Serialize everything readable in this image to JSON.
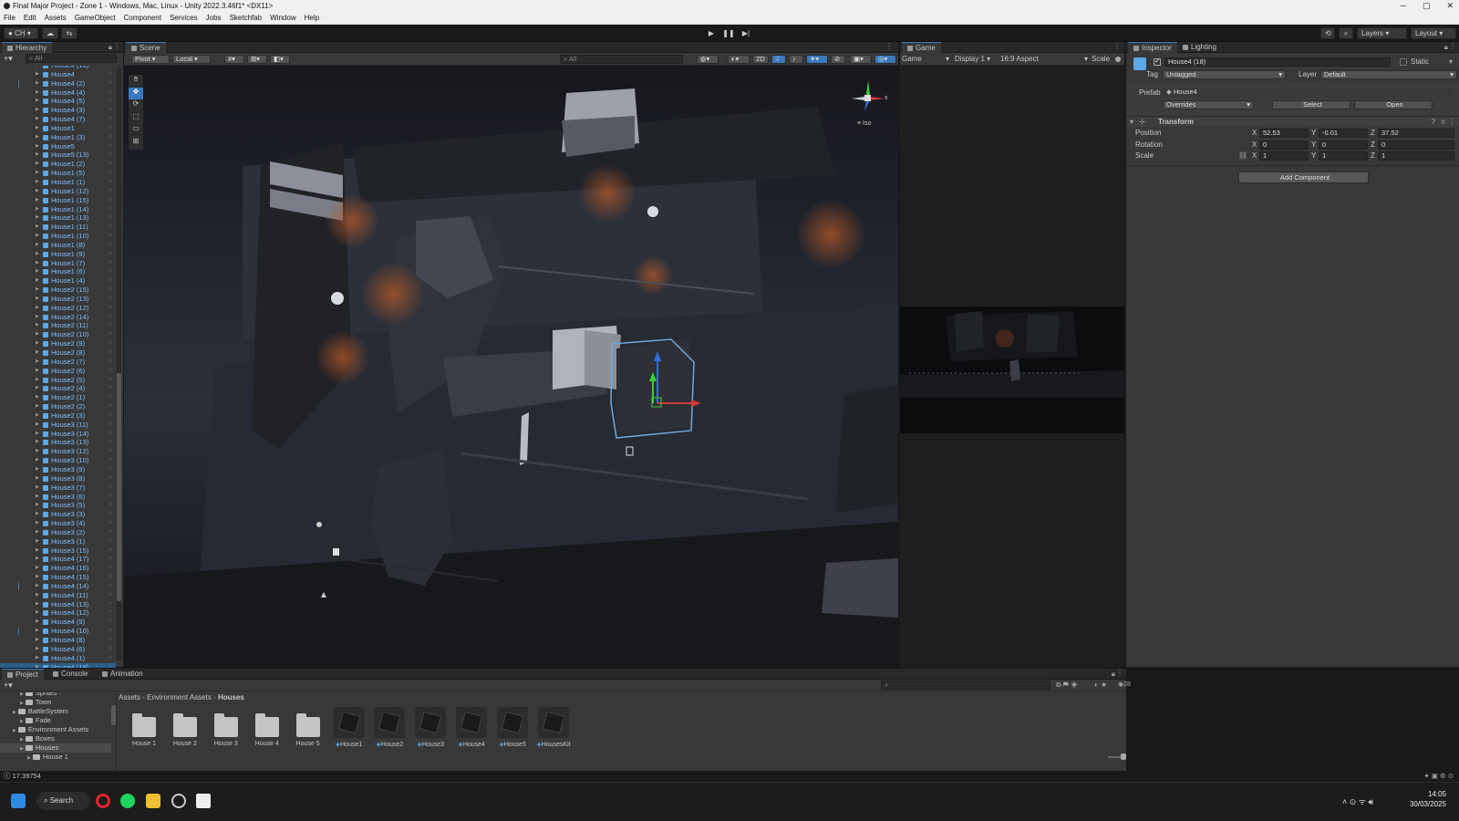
{
  "window": {
    "title": "Final Major Project - Zone 1 - Windows, Mac, Linux - Unity 2022.3.46f1* <DX11>",
    "controls": [
      "─",
      "▢",
      "✕"
    ]
  },
  "menu": [
    "File",
    "Edit",
    "Assets",
    "GameObject",
    "Component",
    "Services",
    "Jobs",
    "Sketchfab",
    "Window",
    "Help"
  ],
  "toolbar": {
    "account": "CH",
    "layers": "Layers",
    "layout": "Layout"
  },
  "hierarchy": {
    "tab": "Hierarchy",
    "search_placeholder": "All",
    "items": [
      {
        "label": "House4 (16)",
        "mark": false
      },
      {
        "label": "House4",
        "mark": false
      },
      {
        "label": "House4 (2)",
        "mark": true
      },
      {
        "label": "House4 (4)",
        "mark": false
      },
      {
        "label": "House4 (5)",
        "mark": false
      },
      {
        "label": "House4 (3)",
        "mark": false
      },
      {
        "label": "House4 (7)",
        "mark": false
      },
      {
        "label": "House1",
        "mark": false
      },
      {
        "label": "House1 (3)",
        "mark": false
      },
      {
        "label": "House5",
        "mark": false
      },
      {
        "label": "House5 (13)",
        "mark": false
      },
      {
        "label": "House1 (2)",
        "mark": false
      },
      {
        "label": "House1 (5)",
        "mark": false
      },
      {
        "label": "House1 (1)",
        "mark": false
      },
      {
        "label": "House1 (12)",
        "mark": false
      },
      {
        "label": "House1 (15)",
        "mark": false
      },
      {
        "label": "House1 (14)",
        "mark": false
      },
      {
        "label": "House1 (13)",
        "mark": false
      },
      {
        "label": "House1 (11)",
        "mark": false
      },
      {
        "label": "House1 (10)",
        "mark": false
      },
      {
        "label": "House1 (8)",
        "mark": false
      },
      {
        "label": "House1 (9)",
        "mark": false
      },
      {
        "label": "House1 (7)",
        "mark": false
      },
      {
        "label": "House1 (6)",
        "mark": false
      },
      {
        "label": "House1 (4)",
        "mark": false
      },
      {
        "label": "House2 (15)",
        "mark": false
      },
      {
        "label": "House2 (13)",
        "mark": false
      },
      {
        "label": "House2 (12)",
        "mark": false
      },
      {
        "label": "House2 (14)",
        "mark": false
      },
      {
        "label": "House2 (11)",
        "mark": false
      },
      {
        "label": "House2 (10)",
        "mark": false
      },
      {
        "label": "House2 (9)",
        "mark": false
      },
      {
        "label": "House2 (8)",
        "mark": false
      },
      {
        "label": "House2 (7)",
        "mark": false
      },
      {
        "label": "House2 (6)",
        "mark": false
      },
      {
        "label": "House2 (5)",
        "mark": false
      },
      {
        "label": "House2 (4)",
        "mark": false
      },
      {
        "label": "House2 (1)",
        "mark": false
      },
      {
        "label": "House2 (2)",
        "mark": false
      },
      {
        "label": "House2 (3)",
        "mark": false
      },
      {
        "label": "House3 (11)",
        "mark": false
      },
      {
        "label": "House3 (14)",
        "mark": false
      },
      {
        "label": "House3 (13)",
        "mark": false
      },
      {
        "label": "House3 (12)",
        "mark": false
      },
      {
        "label": "House3 (10)",
        "mark": false
      },
      {
        "label": "House3 (9)",
        "mark": false
      },
      {
        "label": "House3 (8)",
        "mark": false
      },
      {
        "label": "House3 (7)",
        "mark": false
      },
      {
        "label": "House3 (6)",
        "mark": false
      },
      {
        "label": "House3 (5)",
        "mark": false
      },
      {
        "label": "House3 (3)",
        "mark": false
      },
      {
        "label": "House3 (4)",
        "mark": false
      },
      {
        "label": "House3 (2)",
        "mark": false
      },
      {
        "label": "House3 (1)",
        "mark": false
      },
      {
        "label": "House3 (15)",
        "mark": false
      },
      {
        "label": "House4 (17)",
        "mark": false
      },
      {
        "label": "House4 (16)",
        "mark": false
      },
      {
        "label": "House4 (15)",
        "mark": false
      },
      {
        "label": "House4 (14)",
        "mark": true
      },
      {
        "label": "House4 (11)",
        "mark": false
      },
      {
        "label": "House4 (13)",
        "mark": false
      },
      {
        "label": "House4 (12)",
        "mark": false
      },
      {
        "label": "House4 (9)",
        "mark": false
      },
      {
        "label": "House4 (10)",
        "mark": true
      },
      {
        "label": "House4 (8)",
        "mark": false
      },
      {
        "label": "House4 (6)",
        "mark": false
      },
      {
        "label": "House4 (1)",
        "mark": false
      },
      {
        "label": "House4 (18)",
        "mark": false,
        "selected": true
      }
    ]
  },
  "scene": {
    "tab": "Scene",
    "pivot": "Pivot",
    "local": "Local",
    "search_placeholder": "All",
    "mode_2d": "2D",
    "gizmo_label": "Iso",
    "gizmo_x": "x"
  },
  "game": {
    "tab": "Game",
    "display_mode": "Game",
    "display": "Display 1",
    "aspect": "16:9 Aspect",
    "scale": "Scale"
  },
  "inspector": {
    "tab": "Inspector",
    "tab2": "Lighting",
    "object_name": "House4 (18)",
    "static_label": "Static",
    "tag_label": "Tag",
    "tag_value": "Untagged",
    "layer_label": "Layer",
    "layer_value": "Default",
    "prefab_label": "Prefab",
    "prefab_value": "House4",
    "overrides": "Overrides",
    "select": "Select",
    "open": "Open",
    "component": "Transform",
    "position": {
      "label": "Position",
      "x": "52.53",
      "y": "-0.01",
      "z": "37.52"
    },
    "rotation": {
      "label": "Rotation",
      "x": "0",
      "y": "0",
      "z": "0"
    },
    "scale": {
      "label": "Scale",
      "x": "1",
      "y": "1",
      "z": "1"
    },
    "axis": {
      "x": "X",
      "y": "Y",
      "z": "Z"
    },
    "add_component": "Add Component"
  },
  "project": {
    "tabs": [
      "Project",
      "Console",
      "Animation"
    ],
    "breadcrumb": [
      "Assets",
      "Environment Assets",
      "Houses"
    ],
    "count": "28",
    "tree": [
      {
        "label": "Sprites",
        "indent": 2
      },
      {
        "label": "Town",
        "indent": 2
      },
      {
        "label": "BattleSystem",
        "indent": 1
      },
      {
        "label": "Fade",
        "indent": 2
      },
      {
        "label": "Environment Assets",
        "indent": 1
      },
      {
        "label": "Boxes",
        "indent": 2
      },
      {
        "label": "Houses",
        "indent": 2,
        "selected": true
      },
      {
        "label": "House 1",
        "indent": 3
      }
    ],
    "assets": [
      {
        "label": "House 1",
        "kind": "folder"
      },
      {
        "label": "House 2",
        "kind": "folder"
      },
      {
        "label": "House 3",
        "kind": "folder"
      },
      {
        "label": "House 4",
        "kind": "folder"
      },
      {
        "label": "House 5",
        "kind": "folder"
      },
      {
        "label": "House1",
        "kind": "prefab"
      },
      {
        "label": "House2",
        "kind": "prefab"
      },
      {
        "label": "House3",
        "kind": "prefab"
      },
      {
        "label": "House4",
        "kind": "prefab"
      },
      {
        "label": "House5",
        "kind": "prefab"
      },
      {
        "label": "HousesKit",
        "kind": "prefab"
      }
    ]
  },
  "status": {
    "text": "17.39754"
  },
  "taskbar": {
    "search": "Search",
    "time": "14:05",
    "date": "30/03/2025"
  },
  "colors": {
    "accent": "#3a79bb",
    "hierarchy_text": "#7ec0ff",
    "panel": "#383838",
    "selection": "#2c5d87"
  }
}
